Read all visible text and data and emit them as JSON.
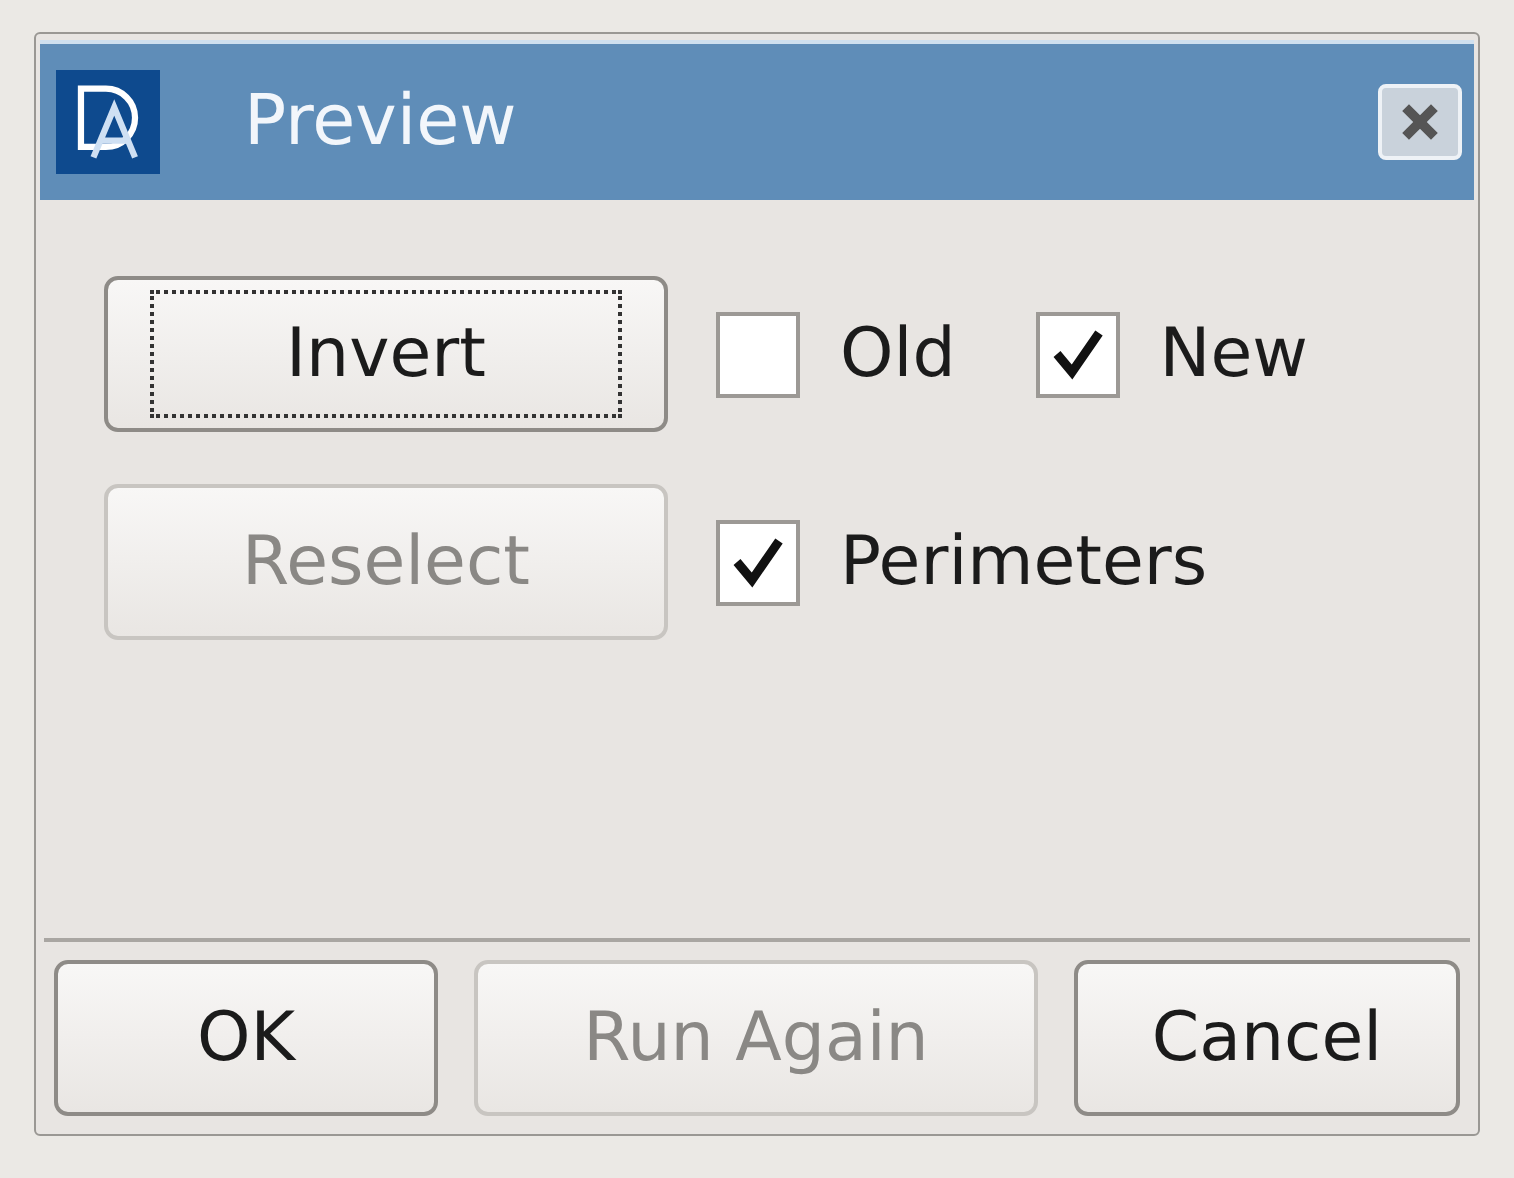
{
  "window": {
    "title": "Preview"
  },
  "rows": [
    {
      "button": {
        "label": "Invert",
        "disabled": false,
        "focused": true
      },
      "checkboxes": [
        {
          "label": "Old",
          "checked": false
        },
        {
          "label": "New",
          "checked": true
        }
      ]
    },
    {
      "button": {
        "label": "Reselect",
        "disabled": true,
        "focused": false
      },
      "checkboxes": [
        {
          "label": "Perimeters",
          "checked": true
        }
      ]
    }
  ],
  "buttons": [
    {
      "label": "OK",
      "disabled": false
    },
    {
      "label": "Run Again",
      "disabled": true
    },
    {
      "label": "Cancel",
      "disabled": false
    }
  ]
}
